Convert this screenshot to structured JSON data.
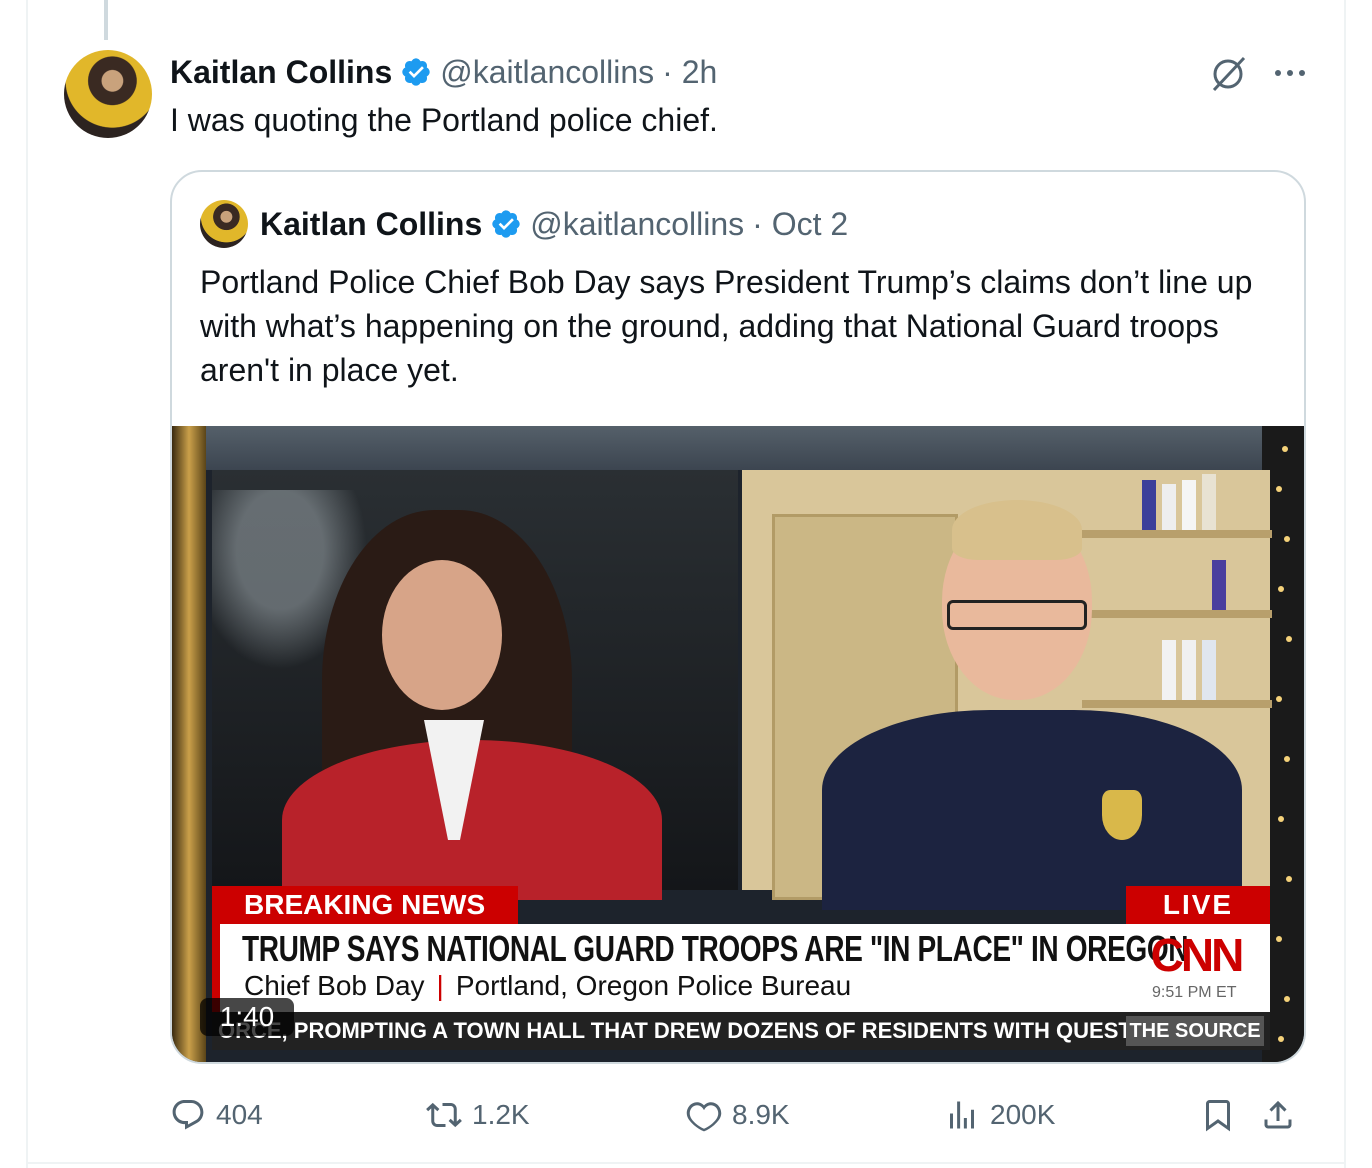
{
  "author": {
    "name": "Kaitlan Collins",
    "handle": "@kaitlancollins",
    "time": "· 2h"
  },
  "tweet": {
    "text": "I was quoting the Portland police chief."
  },
  "quoted": {
    "name": "Kaitlan Collins",
    "handle": "@kaitlancollins",
    "time": "· Oct 2",
    "text": "Portland Police Chief Bob Day says President Trump’s claims don’t line up with what’s happening on the ground, adding that National Guard troops aren't in place yet.",
    "video": {
      "duration": "1:40",
      "breaking_label": "BREAKING NEWS",
      "live_label": "LIVE",
      "headline": "TRUMP SAYS NATIONAL GUARD TROOPS ARE \"IN PLACE\" IN OREGON",
      "guest_name": "Chief Bob Day",
      "guest_org": "Portland, Oregon Police Bureau",
      "network": "CNN",
      "clock": "9:51 PM ET",
      "ticker": "ORCE, PROMPTING A TOWN HALL THAT DREW DOZENS OF RESIDENTS WITH QUESTION",
      "show": "THE SOURCE"
    }
  },
  "actions": {
    "replies": "404",
    "reposts": "1.2K",
    "likes": "8.9K",
    "views": "200K"
  },
  "colors": {
    "verified": "#1d9bf0",
    "secondary_text": "#536471",
    "cnn_red": "#cc0000",
    "border": "#cfd9de"
  },
  "icons": [
    "verified-badge-icon",
    "grok-icon",
    "more-icon",
    "reply-icon",
    "repost-icon",
    "like-icon",
    "views-icon",
    "bookmark-icon",
    "share-icon"
  ]
}
